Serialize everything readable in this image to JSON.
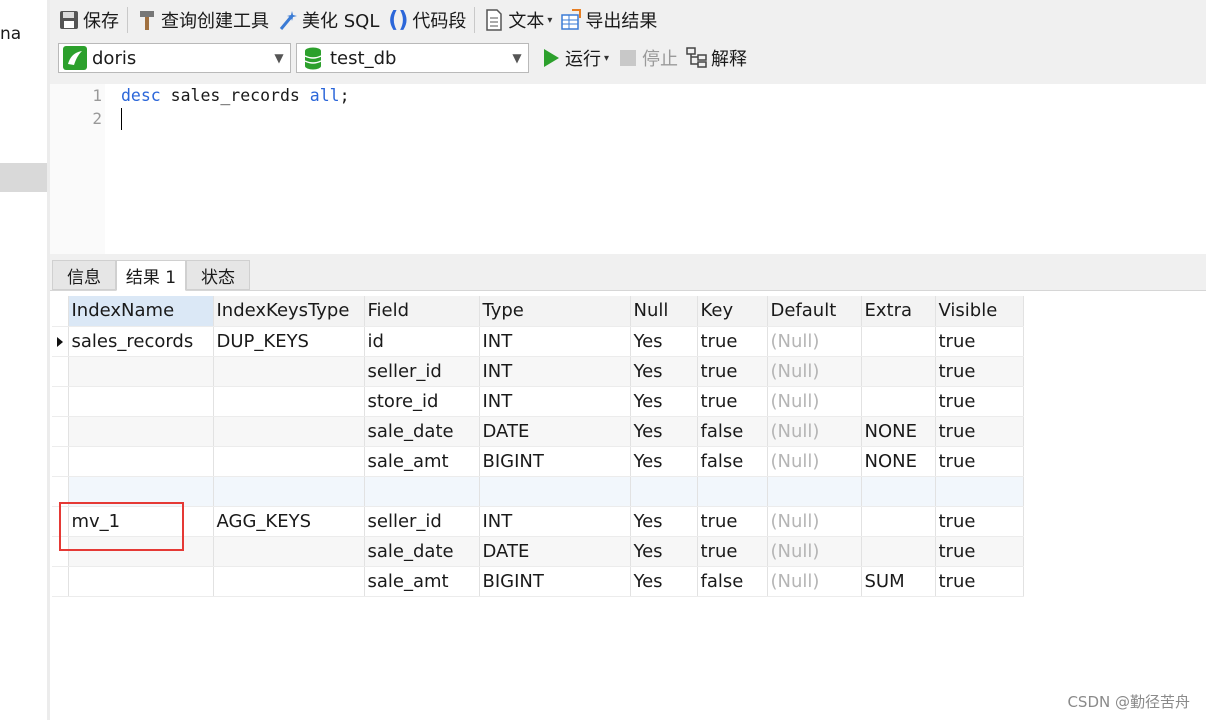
{
  "left_panel": {
    "cut_text": "na"
  },
  "toolbar": {
    "save": "保存",
    "query_builder": "查询创建工具",
    "beautify": "美化 SQL",
    "snippet": "代码段",
    "text": "文本",
    "export": "导出结果",
    "run": "运行",
    "stop": "停止",
    "explain": "解释"
  },
  "connection": {
    "value": "doris"
  },
  "database": {
    "value": "test_db"
  },
  "editor": {
    "lines": [
      {
        "num": "1",
        "kw1": "desc",
        "mid": " sales_records ",
        "kw2": "all",
        "end": ";"
      },
      {
        "num": "2"
      }
    ]
  },
  "tabs": {
    "info": "信息",
    "result1": "结果 1",
    "status": "状态"
  },
  "result": {
    "columns": [
      "IndexName",
      "IndexKeysType",
      "Field",
      "Type",
      "Null",
      "Key",
      "Default",
      "Extra",
      "Visible"
    ],
    "null_text": "(Null)",
    "rows": [
      [
        "sales_records",
        "DUP_KEYS",
        "id",
        "INT",
        "Yes",
        "true",
        "(Null)",
        "",
        "true"
      ],
      [
        "",
        "",
        "seller_id",
        "INT",
        "Yes",
        "true",
        "(Null)",
        "",
        "true"
      ],
      [
        "",
        "",
        "store_id",
        "INT",
        "Yes",
        "true",
        "(Null)",
        "",
        "true"
      ],
      [
        "",
        "",
        "sale_date",
        "DATE",
        "Yes",
        "false",
        "(Null)",
        "NONE",
        "true"
      ],
      [
        "",
        "",
        "sale_amt",
        "BIGINT",
        "Yes",
        "false",
        "(Null)",
        "NONE",
        "true"
      ],
      [
        "",
        "",
        "",
        "",
        "",
        "",
        "",
        "",
        ""
      ],
      [
        "mv_1",
        "AGG_KEYS",
        "seller_id",
        "INT",
        "Yes",
        "true",
        "(Null)",
        "",
        "true"
      ],
      [
        "",
        "",
        "sale_date",
        "DATE",
        "Yes",
        "true",
        "(Null)",
        "",
        "true"
      ],
      [
        "",
        "",
        "sale_amt",
        "BIGINT",
        "Yes",
        "false",
        "(Null)",
        "SUM",
        "true"
      ]
    ]
  },
  "watermark": "CSDN @勤径苦舟",
  "colors": {
    "keyword": "#2b66d9",
    "null": "#b5b5b5",
    "highlight_box": "#e53935"
  }
}
